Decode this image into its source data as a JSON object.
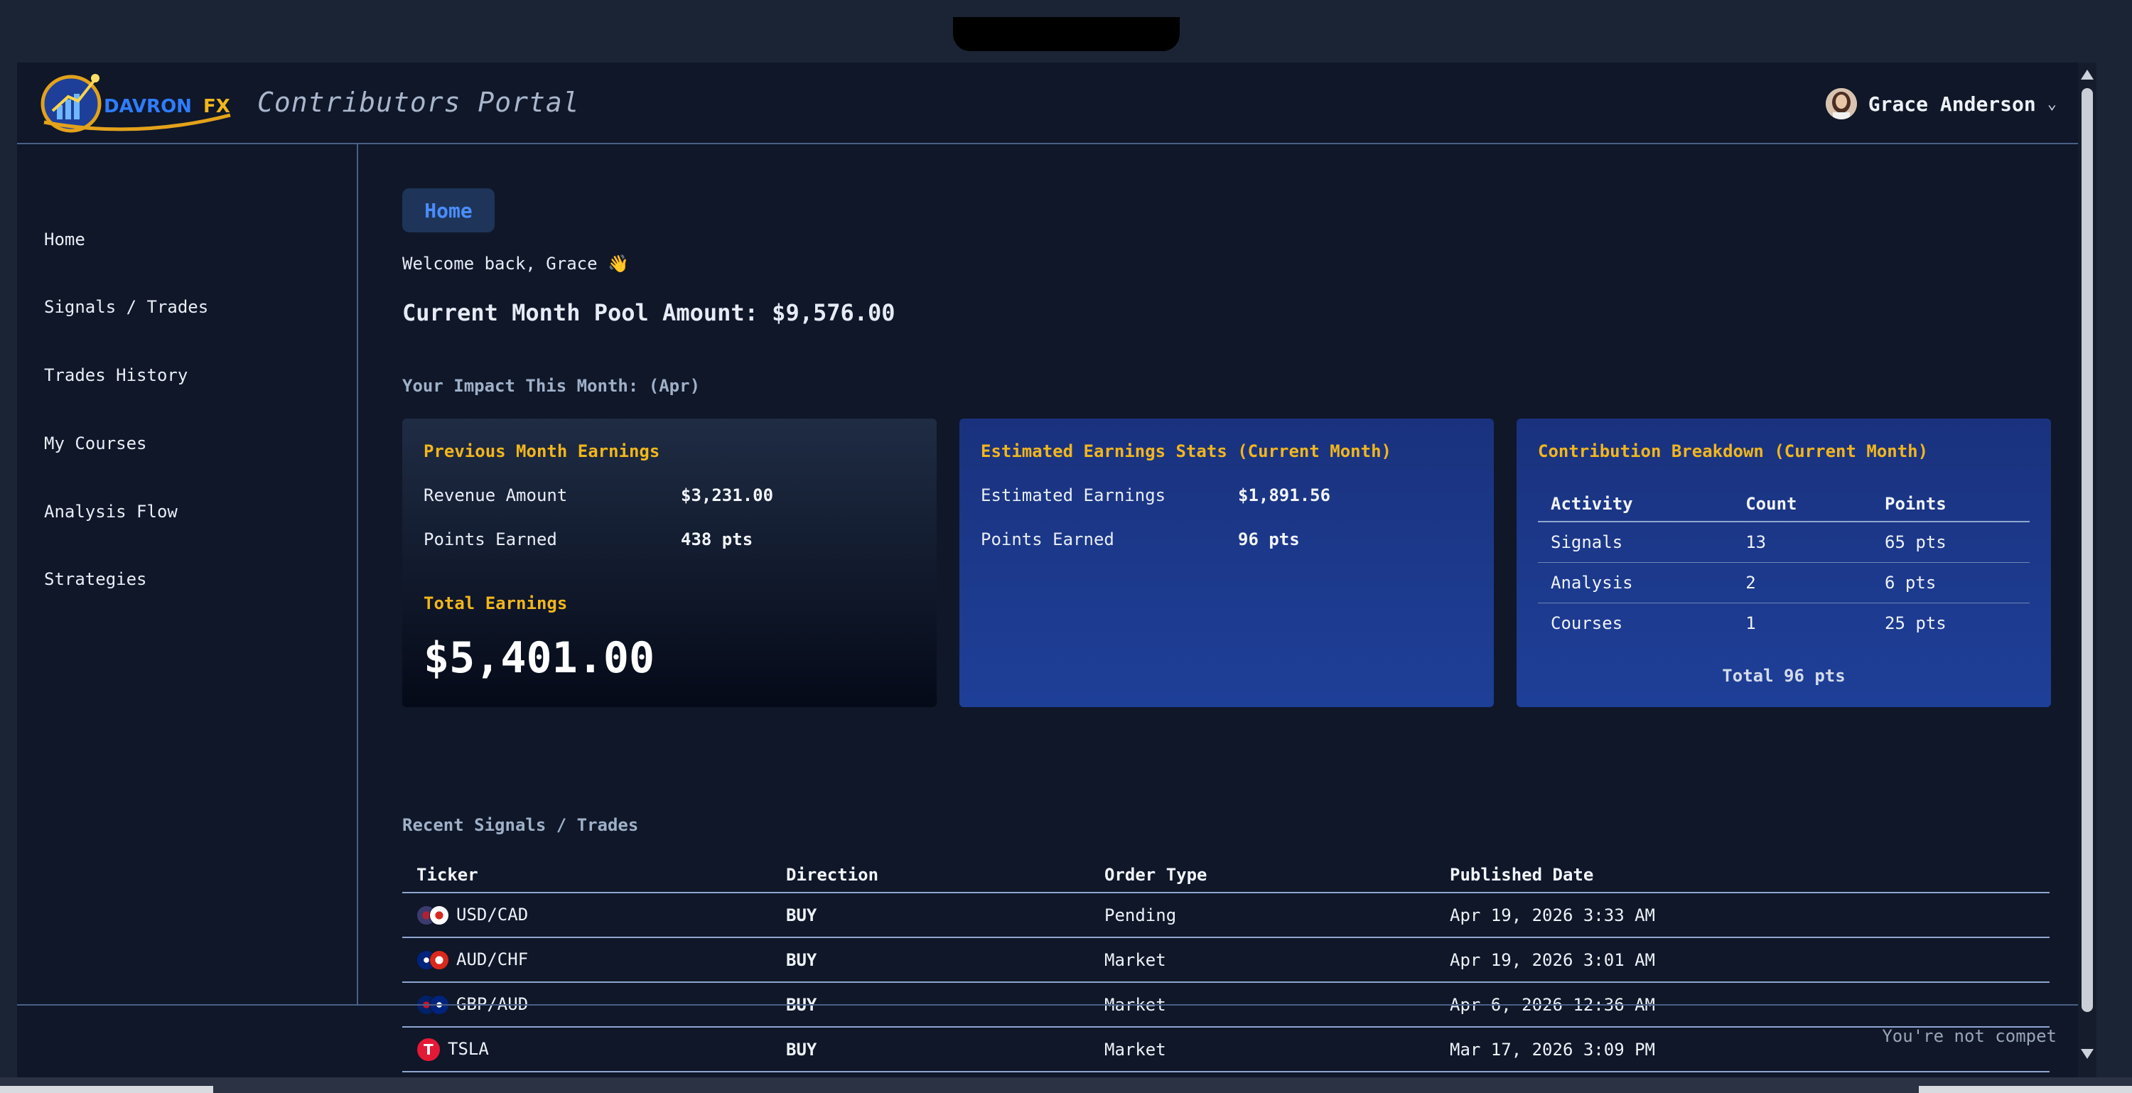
{
  "header": {
    "logo_text_a": "DAVRON",
    "logo_text_b": "FX",
    "portal_title": "Contributors Portal",
    "user_name": "Grace Anderson"
  },
  "sidebar": {
    "items": [
      {
        "label": "Home"
      },
      {
        "label": "Signals / Trades"
      },
      {
        "label": "Trades History"
      },
      {
        "label": "My Courses"
      },
      {
        "label": "Analysis Flow"
      },
      {
        "label": "Strategies"
      }
    ]
  },
  "main": {
    "breadcrumb": "Home",
    "welcome": "Welcome back, Grace 👋",
    "pool_amount": "Current Month Pool Amount: $9,576.00",
    "impact_title": "Your Impact This Month: (Apr)",
    "previous": {
      "title": "Previous Month Earnings",
      "revenue_label": "Revenue Amount",
      "revenue_value": "$3,231.00",
      "points_label": "Points Earned",
      "points_value": "438 pts",
      "total_label": "Total Earnings",
      "total_value": "$5,401.00"
    },
    "estimated": {
      "title": "Estimated Earnings Stats (Current Month)",
      "earnings_label": "Estimated Earnings",
      "earnings_value": "$1,891.56",
      "points_label": "Points Earned",
      "points_value": "96 pts"
    },
    "breakdown": {
      "title": "Contribution Breakdown (Current Month)",
      "columns": [
        "Activity",
        "Count",
        "Points"
      ],
      "rows": [
        [
          "Signals",
          "13",
          "65 pts"
        ],
        [
          "Analysis",
          "2",
          "6 pts"
        ],
        [
          "Courses",
          "1",
          "25 pts"
        ]
      ],
      "total": "Total 96 pts"
    },
    "recent": {
      "title": "Recent Signals / Trades",
      "columns": [
        "Ticker",
        "Direction",
        "Order Type",
        "Published Date"
      ],
      "rows": [
        {
          "ticker": "USD/CAD",
          "direction": "BUY",
          "order_type": "Pending",
          "date": "Apr 19, 2026 3:33 AM"
        },
        {
          "ticker": "AUD/CHF",
          "direction": "BUY",
          "order_type": "Market",
          "date": "Apr 19, 2026 3:01 AM"
        },
        {
          "ticker": "GBP/AUD",
          "direction": "BUY",
          "order_type": "Market",
          "date": "Apr 6, 2026 12:36 AM"
        },
        {
          "ticker": "TSLA",
          "direction": "BUY",
          "order_type": "Market",
          "date": "Mar 17, 2026 3:09 PM"
        }
      ]
    }
  },
  "footer": {
    "text": "You're not compet"
  },
  "colors": {
    "accent_gold": "#f2b61d",
    "accent_blue": "#4a8dff",
    "buy_green": "#22c55e",
    "card_blue": "#1e3f98"
  }
}
